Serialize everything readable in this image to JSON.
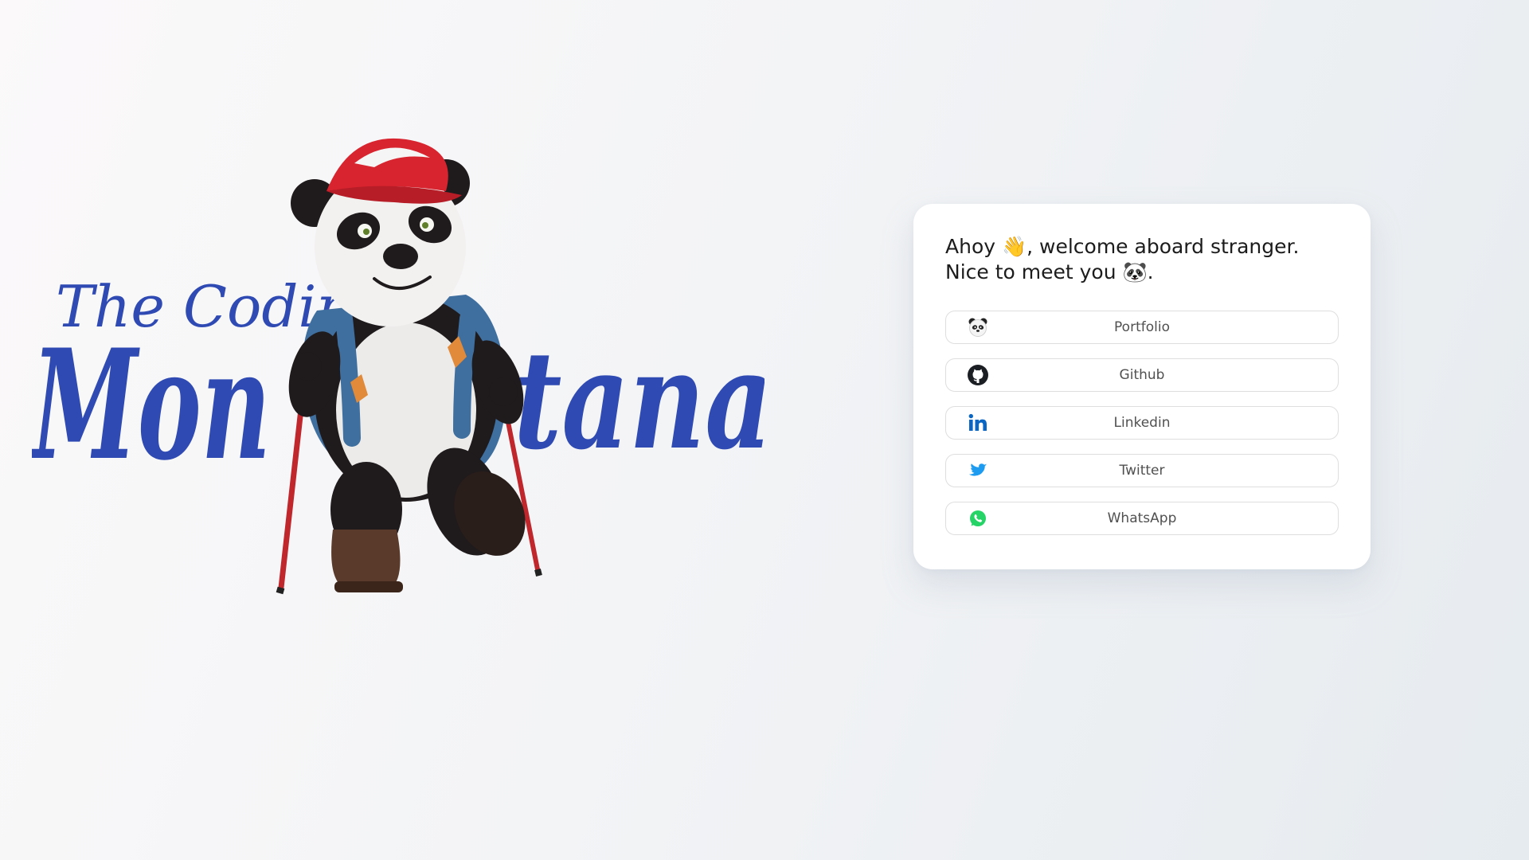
{
  "logo": {
    "line1": "The Coding",
    "line2_left": "Mon",
    "line2_right": "tana"
  },
  "card": {
    "greeting": "Ahoy 👋, welcome aboard stranger. Nice to meet you 🐼."
  },
  "links": [
    {
      "label": "Portfolio",
      "icon": "panda-icon"
    },
    {
      "label": "Github",
      "icon": "github-icon"
    },
    {
      "label": "Linkedin",
      "icon": "linkedin-icon"
    },
    {
      "label": "Twitter",
      "icon": "twitter-icon"
    },
    {
      "label": "WhatsApp",
      "icon": "whatsapp-icon"
    }
  ],
  "colors": {
    "brand": "#2f4bb3",
    "linkedin": "#0a66c2",
    "twitter": "#1d9bf0",
    "whatsapp": "#25d366",
    "github": "#1b1f24"
  }
}
